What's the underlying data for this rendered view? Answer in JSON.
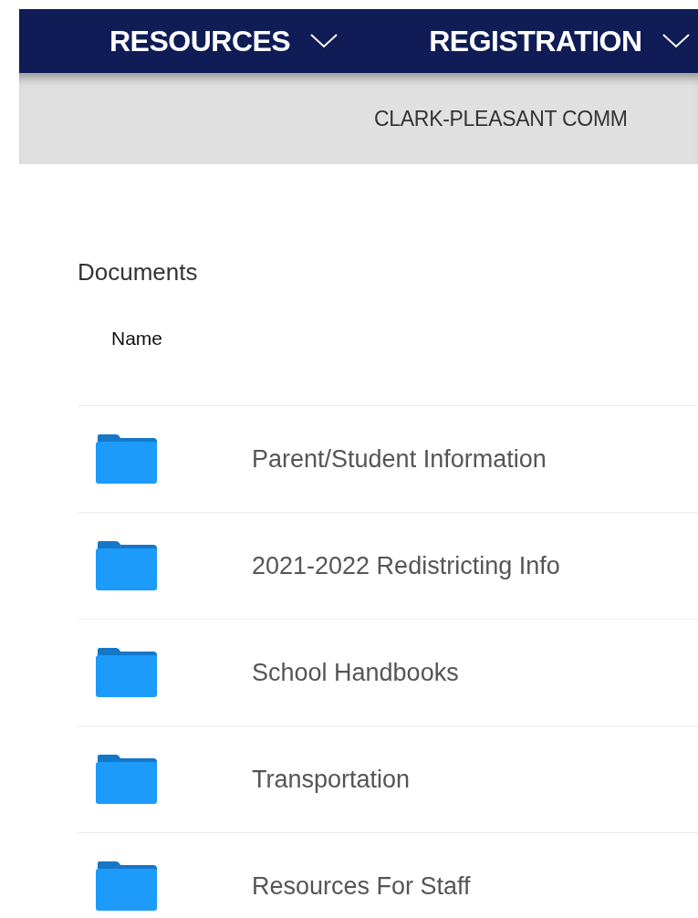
{
  "nav": {
    "items": [
      {
        "label": "RESOURCES",
        "has_menu": true
      },
      {
        "label": "REGISTRATION",
        "has_menu": true
      }
    ]
  },
  "banner": {
    "text": "CLARK-PLEASANT COMM"
  },
  "documents": {
    "title": "Documents",
    "columns": [
      "Name"
    ],
    "rows": [
      {
        "kind": "folder",
        "name": "Parent/Student Information"
      },
      {
        "kind": "folder",
        "name": "2021-2022 Redistricting Info"
      },
      {
        "kind": "folder",
        "name": "School Handbooks"
      },
      {
        "kind": "folder",
        "name": "Transportation"
      },
      {
        "kind": "folder",
        "name": "Resources For Staff"
      }
    ]
  }
}
